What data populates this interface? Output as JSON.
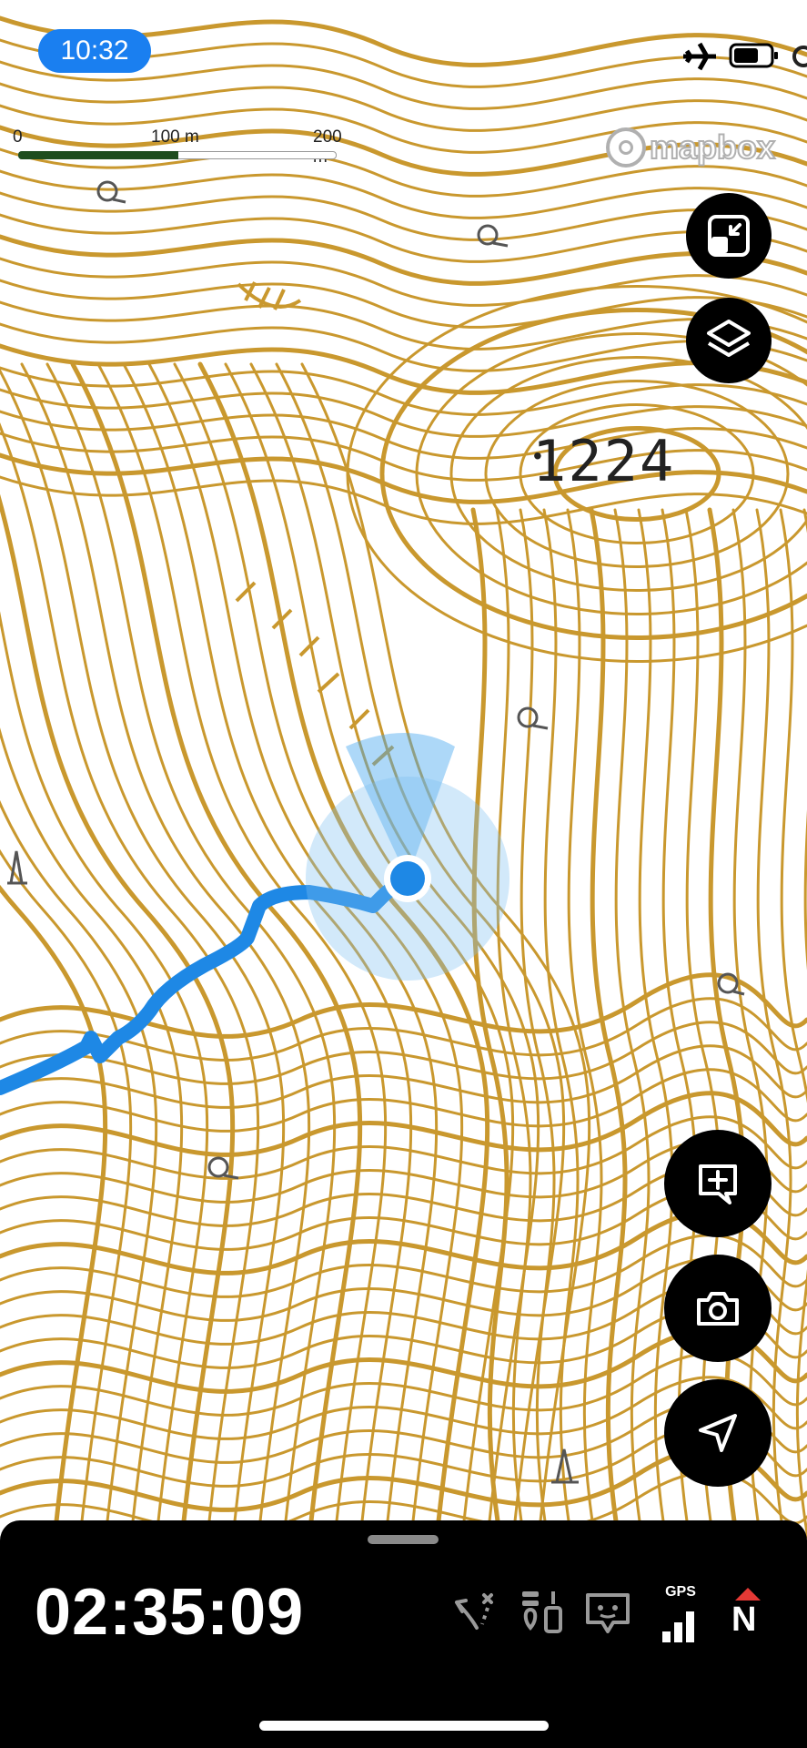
{
  "status_bar": {
    "time": "10:32",
    "airplane_icon": "airplane-icon",
    "battery_icon": "battery-icon"
  },
  "map": {
    "scale_labels": [
      "0",
      "100 m",
      "200 m"
    ],
    "elevation_label": "1224",
    "provider_logo": "mapbox",
    "contour_color": "#c9982e",
    "track_color": "#1e88e5",
    "location_color": "#1e88e5"
  },
  "controls": {
    "fit_bounds_icon": "fit-bounds-icon",
    "layers_icon": "layers-icon",
    "add_note_icon": "add-note-icon",
    "camera_icon": "camera-icon",
    "locate_icon": "locate-icon"
  },
  "bottom_panel": {
    "elapsed_time": "02:35:09",
    "route_icon": "route-icon",
    "waypoints_icon": "waypoints-icon",
    "chat_icon": "chat-icon",
    "gps_label": "GPS",
    "north_label": "N"
  }
}
